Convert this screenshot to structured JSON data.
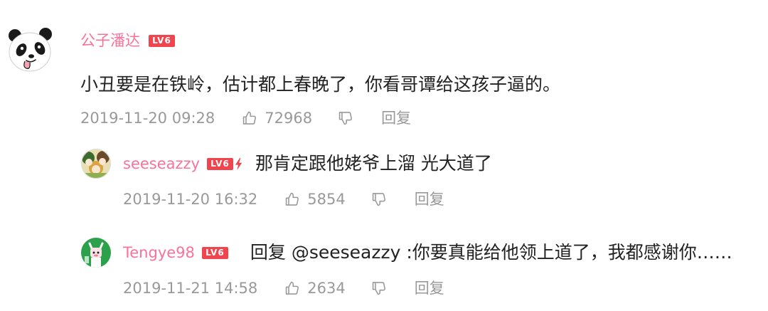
{
  "colors": {
    "username": "#fb7299",
    "text": "#222222",
    "meta": "#999999",
    "level_badge": "#f0454f"
  },
  "icons": {
    "like": "thumbs-up-icon",
    "dislike": "thumbs-down-icon",
    "hardcore_badge": "lightning-icon"
  },
  "comment": {
    "username": "公子潘达",
    "level": "LV6",
    "text": "小丑要是在铁岭，估计都上春晚了，你看哥谭给这孩子逼的。",
    "time": "2019-11-20 09:28",
    "likes": 72968,
    "reply_label": "回复"
  },
  "replies": [
    {
      "username": "seeseazzy",
      "level": "LV6",
      "text": "那肯定跟他姥爷上溜 光大道了",
      "time": "2019-11-20 16:32",
      "likes": 5854,
      "reply_label": "回复"
    },
    {
      "username": "Tengye98",
      "level": "LV6",
      "reply_prefix": "回复 ",
      "mention": "@seeseazzy",
      "text": " :你要真能给他领上道了，我都感谢你……",
      "time": "2019-11-21 14:58",
      "likes": 2634,
      "reply_label": "回复"
    }
  ]
}
